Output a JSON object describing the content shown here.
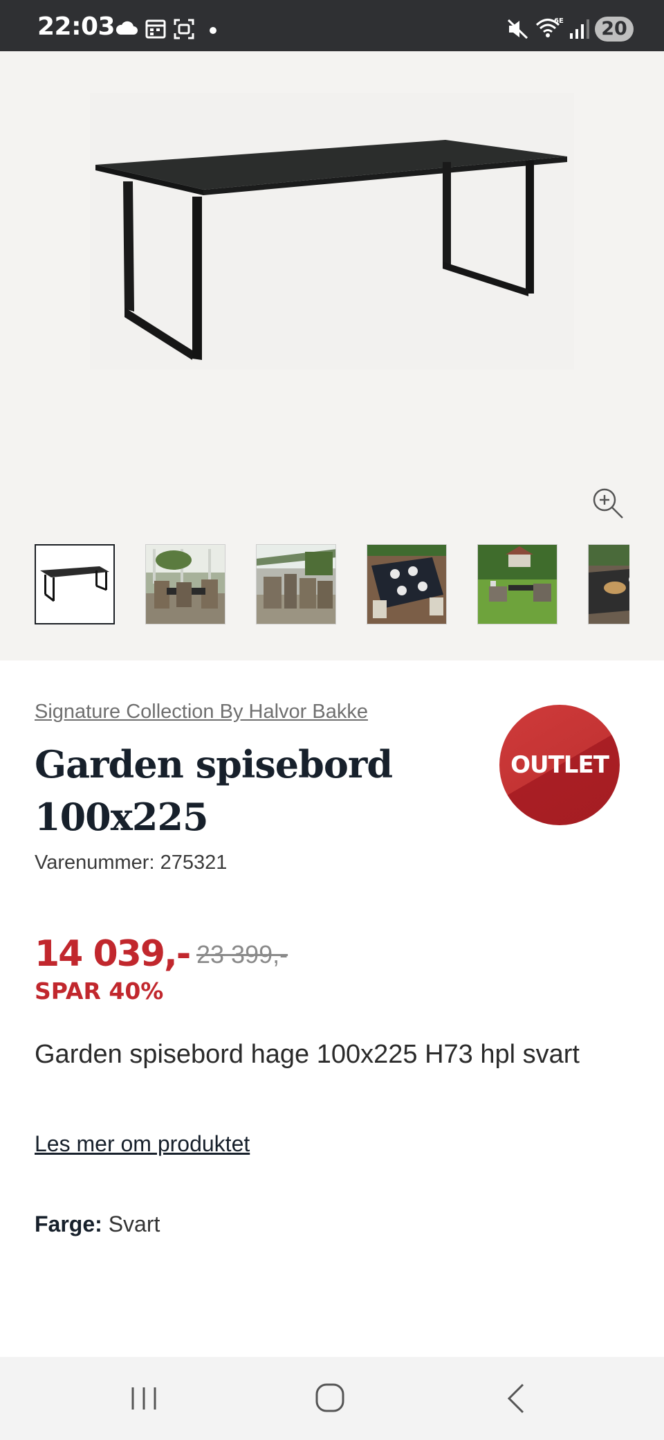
{
  "status_bar": {
    "time": "22:03",
    "left_icons": [
      "cloud-icon",
      "calendar-icon",
      "screenshot-icon",
      "dot-icon"
    ],
    "right_icons": [
      "mute-icon",
      "wifi-6e-icon",
      "signal-icon"
    ],
    "battery": "20"
  },
  "gallery": {
    "main_image": "black-dining-table-photo",
    "zoom_icon": "zoom-in-icon",
    "thumbnails": [
      {
        "name": "table-product-shot",
        "active": true
      },
      {
        "name": "garden-dining-set-photo-1",
        "active": false
      },
      {
        "name": "garden-dining-set-photo-2",
        "active": false
      },
      {
        "name": "table-setting-top-view-photo",
        "active": false
      },
      {
        "name": "lawn-dining-photo",
        "active": false
      },
      {
        "name": "table-closeup-photo",
        "active": false
      }
    ]
  },
  "product": {
    "brand": "Signature Collection By Halvor Bakke",
    "title": "Garden spisebord 100x225",
    "sku": "Varenummer: 275321",
    "badge": "OUTLET",
    "price": "14 039,-",
    "old_price": "23 399,-",
    "save": "SPAR 40%",
    "description": "Garden spisebord hage 100x225 H73 hpl svart",
    "read_more": "Les mer om produktet",
    "color_label": "Farge:",
    "color_value": "Svart"
  },
  "colors": {
    "sale_red": "#c1272d",
    "title_navy": "#17202b",
    "status_bar": "#2f3033",
    "gallery_bg": "#f4f3f1"
  },
  "nav_bar": {
    "buttons": [
      "recent-apps-icon",
      "home-icon",
      "back-icon"
    ]
  }
}
